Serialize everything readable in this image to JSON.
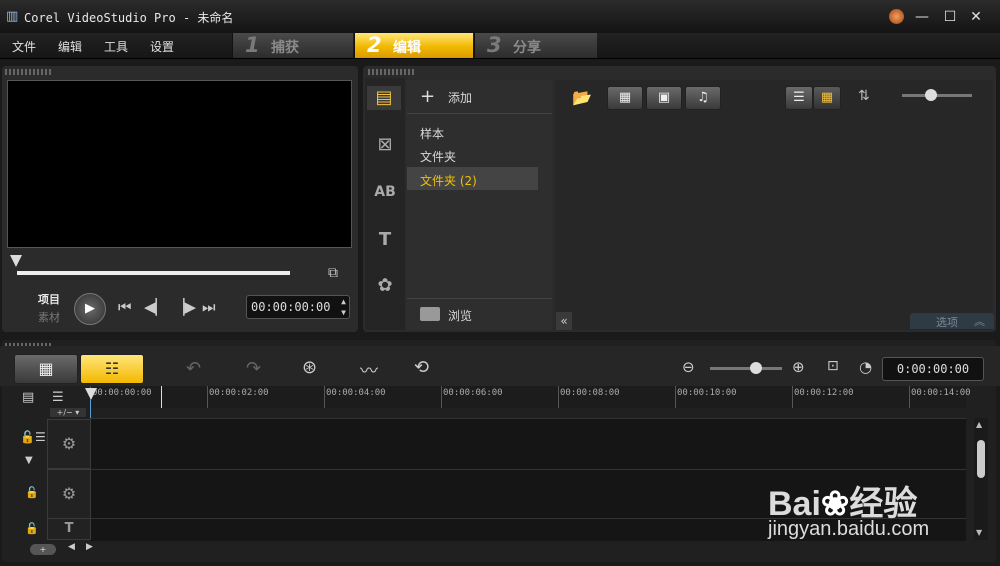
{
  "window": {
    "title": "Corel VideoStudio Pro - 未命名",
    "logo_icon": "videostudio-logo-icon",
    "controls": [
      "orb-icon",
      "minimize-icon",
      "maximize-icon",
      "close-icon"
    ]
  },
  "menu": {
    "items": [
      "文件",
      "编辑",
      "工具",
      "设置"
    ]
  },
  "steps": [
    {
      "num": "1",
      "label": "捕获",
      "active": false
    },
    {
      "num": "2",
      "label": "编辑",
      "active": true
    },
    {
      "num": "3",
      "label": "分享",
      "active": false
    }
  ],
  "preview": {
    "mode_project": "项目",
    "mode_clip": "素材",
    "timecode": "00:00:00:00"
  },
  "library": {
    "add_label": "添加",
    "folders": [
      "样本",
      "文件夹",
      "文件夹 (2)"
    ],
    "selected_folder": "文件夹 (2)",
    "browse_label": "浏览",
    "options_label": "选项",
    "side_icons": [
      "media-icon",
      "transition-icon",
      "title-ab-icon",
      "text-t-icon",
      "filter-icon"
    ]
  },
  "timeline": {
    "timecode": "0:00:00:00",
    "ruler_labels": [
      "00:00:00:00",
      "00:00:02:00",
      "00:00:04:00",
      "00:00:06:00",
      "00:00:08:00",
      "00:00:10:00",
      "00:00:12:00",
      "00:00:14:00"
    ]
  },
  "watermark": {
    "brand": "Bai",
    "brand_cn": "经验",
    "url": "jingyan.baidu.com"
  },
  "colors": {
    "accent": "#f2b800",
    "background": "#1a1a1a"
  }
}
